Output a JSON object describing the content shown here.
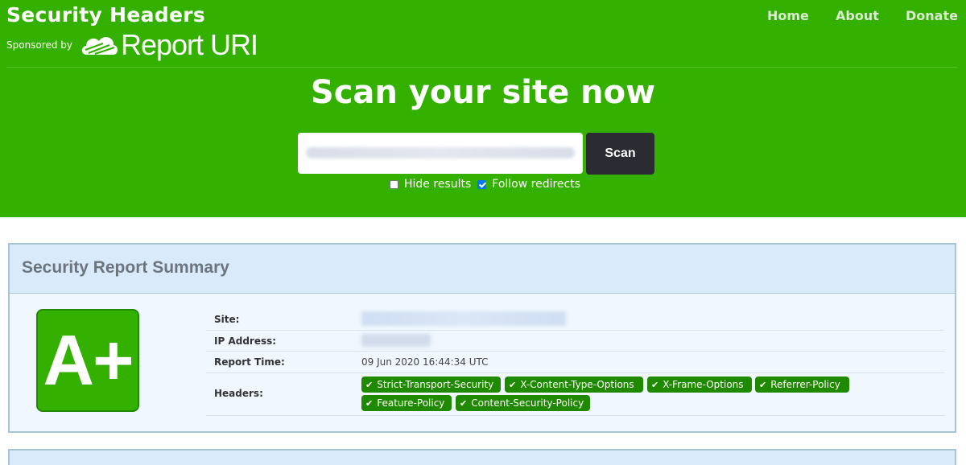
{
  "header": {
    "title": "Security Headers",
    "sponsored_by": "Sponsored by",
    "sponsor_name": "Report URI",
    "nav": [
      "Home",
      "About",
      "Donate"
    ]
  },
  "scan": {
    "title": "Scan your site now",
    "input_placeholder": "",
    "button_label": "Scan",
    "options": [
      {
        "label": "Hide results",
        "checked": false
      },
      {
        "label": "Follow redirects",
        "checked": true
      }
    ]
  },
  "report": {
    "title": "Security Report Summary",
    "grade": "A+",
    "rows": [
      {
        "label": "Site:",
        "value": ""
      },
      {
        "label": "IP Address:",
        "value": ""
      },
      {
        "label": "Report Time:",
        "value": "09 Jun 2020 16:44:34 UTC"
      },
      {
        "label": "Headers:",
        "value": ""
      }
    ],
    "headers": [
      "Strict-Transport-Security",
      "X-Content-Type-Options",
      "X-Frame-Options",
      "Referrer-Policy",
      "Feature-Policy",
      "Content-Security-Policy"
    ]
  },
  "colors": {
    "brand_green": "#33b000",
    "badge_green": "#1f8a00",
    "scan_button": "#2b2b33",
    "panel_header": "#d9eafb"
  },
  "icons": {
    "logo": "cloud-logo-icon",
    "badge": "check-icon"
  }
}
